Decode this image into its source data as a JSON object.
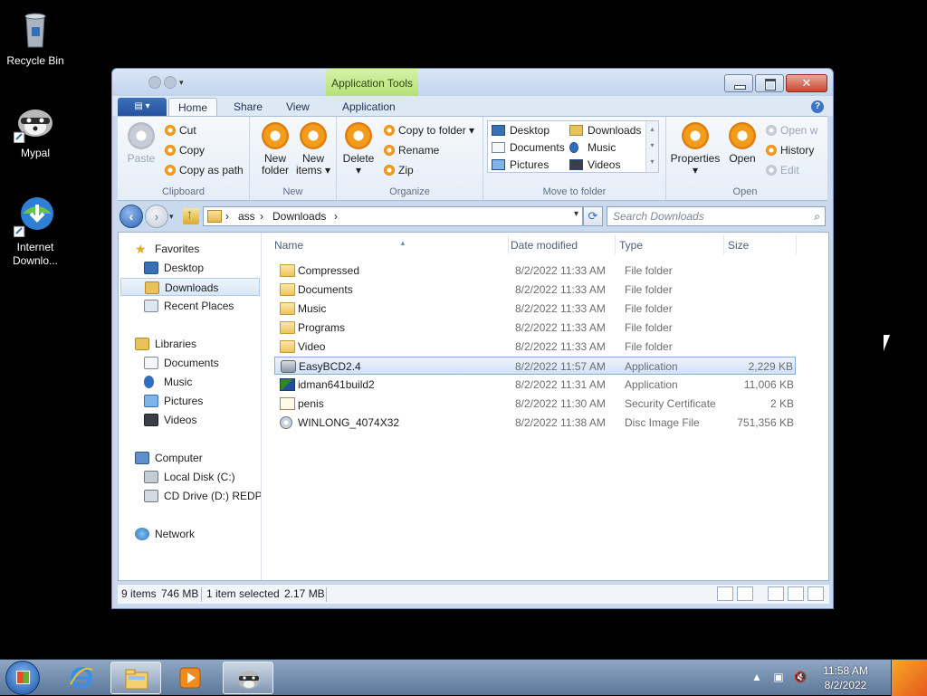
{
  "desktop": {
    "icons": [
      {
        "label": "Recycle Bin",
        "icon": "recycle-bin-icon"
      },
      {
        "label": "Mypal",
        "icon": "mypal-raccoon-icon"
      },
      {
        "label": "Internet Downlo...",
        "line1": "Internet",
        "line2": "Downlo...",
        "icon": "internet-download-manager-icon"
      }
    ]
  },
  "window": {
    "app_tools_header": "Application Tools",
    "tabs": {
      "file": "",
      "home": "Home",
      "share": "Share",
      "view": "View",
      "application": "Application"
    },
    "help": "?"
  },
  "ribbon": {
    "clipboard": {
      "label": "Clipboard",
      "paste": "Paste",
      "cut": "Cut",
      "copy": "Copy",
      "copy_as_path": "Copy as path"
    },
    "new": {
      "label": "New",
      "new_folder_1": "New",
      "new_folder_2": "folder",
      "new_items_1": "New",
      "new_items_2": "items ▾"
    },
    "organize": {
      "label": "Organize",
      "delete": "Delete",
      "delete_dd": "▾",
      "copy_to_folder": "Copy to folder ▾",
      "rename": "Rename",
      "zip": "Zip"
    },
    "move_to_folder": {
      "label": "Move to folder",
      "items": [
        "Desktop",
        "Downloads",
        "Documents",
        "Music",
        "Pictures",
        "Videos"
      ]
    },
    "open": {
      "label": "Open",
      "properties": "Properties",
      "properties_dd": "▾",
      "open": "Open",
      "open_with": "Open w",
      "history": "History",
      "edit": "Edit"
    }
  },
  "address": {
    "crumbs": [
      "ass",
      "Downloads"
    ],
    "search_placeholder": "Search Downloads"
  },
  "nav": {
    "favorites": "Favorites",
    "desktop": "Desktop",
    "downloads": "Downloads",
    "recent_places": "Recent Places",
    "libraries": "Libraries",
    "documents": "Documents",
    "music": "Music",
    "pictures": "Pictures",
    "videos": "Videos",
    "computer": "Computer",
    "local_disk": "Local Disk (C:)",
    "cd_drive": "CD Drive (D:) REDPIL",
    "network": "Network"
  },
  "columns": {
    "name": "Name",
    "date": "Date modified",
    "type": "Type",
    "size": "Size"
  },
  "files": [
    {
      "name": "Compressed",
      "date": "8/2/2022 11:33 AM",
      "type": "File folder",
      "size": "",
      "icon": "folder-icon"
    },
    {
      "name": "Documents",
      "date": "8/2/2022 11:33 AM",
      "type": "File folder",
      "size": "",
      "icon": "folder-icon"
    },
    {
      "name": "Music",
      "date": "8/2/2022 11:33 AM",
      "type": "File folder",
      "size": "",
      "icon": "folder-icon"
    },
    {
      "name": "Programs",
      "date": "8/2/2022 11:33 AM",
      "type": "File folder",
      "size": "",
      "icon": "folder-icon"
    },
    {
      "name": "Video",
      "date": "8/2/2022 11:33 AM",
      "type": "File folder",
      "size": "",
      "icon": "folder-icon"
    },
    {
      "name": "EasyBCD2.4",
      "date": "8/2/2022 11:57 AM",
      "type": "Application",
      "size": "2,229 KB",
      "icon": "application-icon",
      "selected": true
    },
    {
      "name": "idman641build2",
      "date": "8/2/2022 11:31 AM",
      "type": "Application",
      "size": "11,006 KB",
      "icon": "idm-installer-icon"
    },
    {
      "name": "penis",
      "date": "8/2/2022 11:30 AM",
      "type": "Security Certificate",
      "size": "2 KB",
      "icon": "certificate-icon"
    },
    {
      "name": "WINLONG_4074X32",
      "date": "8/2/2022 11:38 AM",
      "type": "Disc Image File",
      "size": "751,356 KB",
      "icon": "disc-image-icon"
    }
  ],
  "status": {
    "items": "9 items",
    "total_size": "746 MB",
    "selected": "1 item selected",
    "selected_size": "2.17 MB"
  },
  "taskbar": {
    "time": "11:58 AM",
    "date": "8/2/2022"
  }
}
